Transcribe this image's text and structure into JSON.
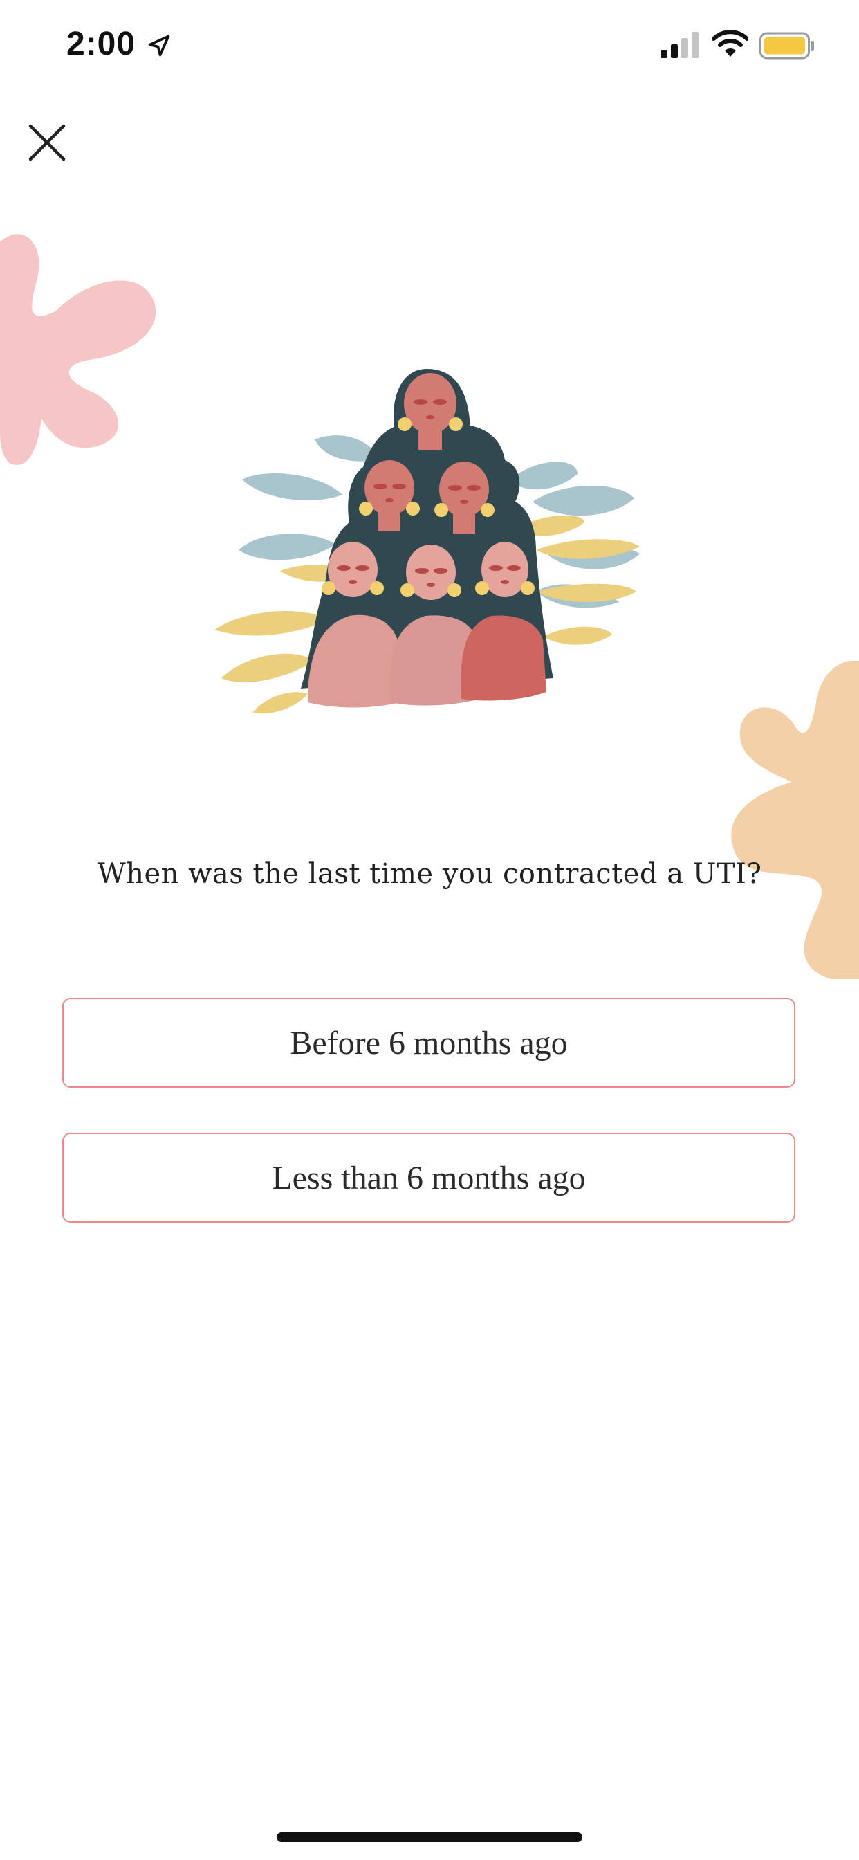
{
  "status_bar": {
    "time": "2:00",
    "location_icon": "location-arrow-icon",
    "signal_icon": "cellular-signal-icon",
    "wifi_icon": "wifi-icon",
    "battery_icon": "battery-icon",
    "battery_color": "#f5c842"
  },
  "header": {
    "close_icon": "close-icon"
  },
  "illustration": {
    "name": "group-of-women-illustration"
  },
  "question": {
    "text": "When was the last time you contracted a UTI?"
  },
  "options": [
    {
      "label": "Before 6 months ago"
    },
    {
      "label": "Less than 6 months ago"
    }
  ],
  "colors": {
    "option_border": "#e88a87",
    "blob_pink": "#f6c6c6",
    "blob_peach": "#f4d0a8"
  }
}
